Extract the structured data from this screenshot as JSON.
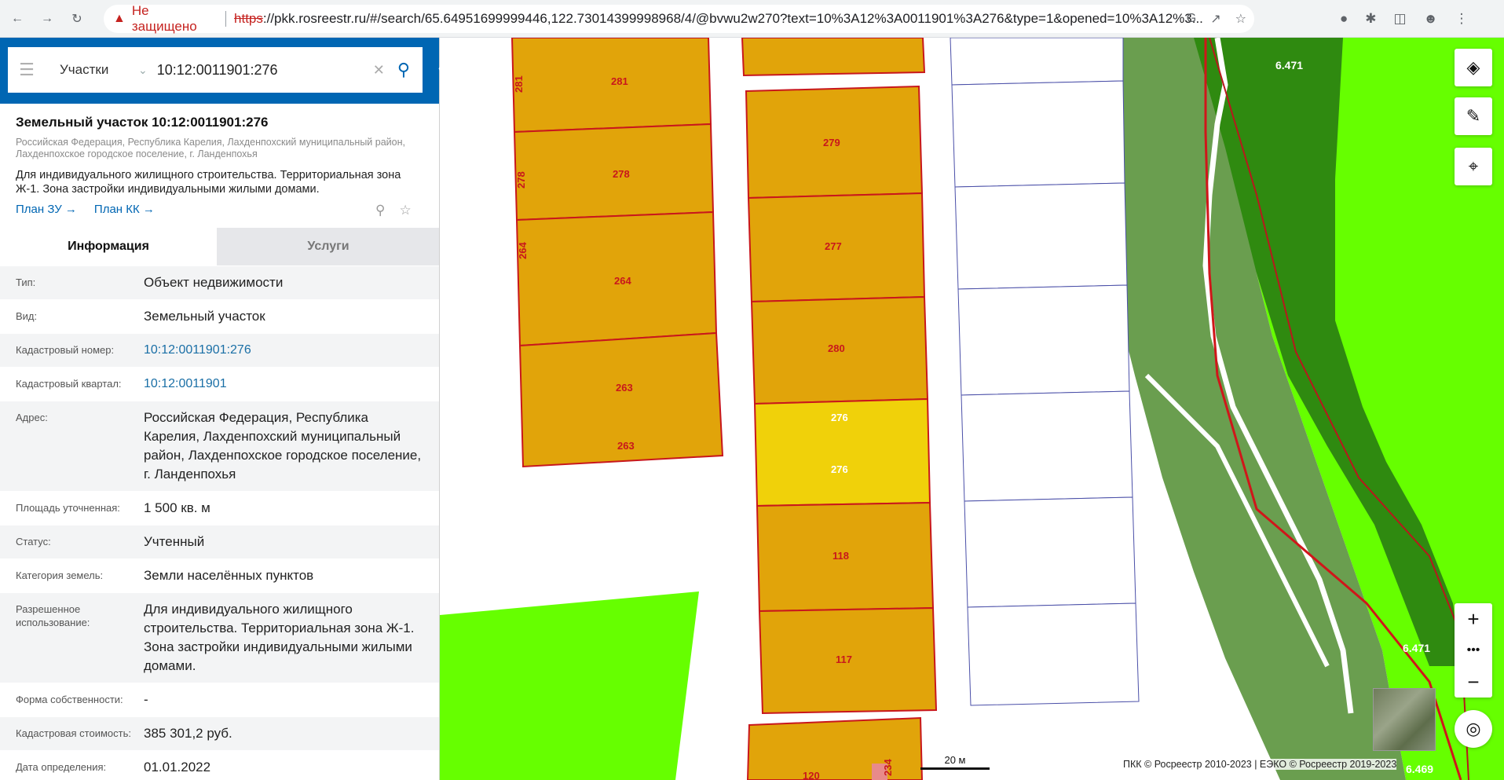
{
  "browser": {
    "warning_label": "Не защищено",
    "url_scheme": "https",
    "url_rest": "://pkk.rosreestr.ru/#/search/65.64951699999446,122.73014399998968/4/@bvwu2w270?text=10%3A12%3A0011901%3A276&type=1&opened=10%3A12%3..."
  },
  "search": {
    "type_label": "Участки",
    "query": "10:12:0011901:276"
  },
  "object": {
    "title": "Земельный участок 10:12:0011901:276",
    "address": "Российская Федерация, Республика Карелия, Лахденпохский муниципальный район, Лахденпохское городское поселение, г. Ланденпохья",
    "description": "Для индивидуального жилищного строительства. Территориальная зона Ж-1. Зона застройки индивидуальными жилыми домами.",
    "link_plan_zu": "План ЗУ →",
    "link_plan_kk": "План КК →"
  },
  "tabs": {
    "info": "Информация",
    "services": "Услуги"
  },
  "info": {
    "type_label": "Тип:",
    "type_value": "Объект недвижимости",
    "kind_label": "Вид:",
    "kind_value": "Земельный участок",
    "cad_num_label": "Кадастровый номер:",
    "cad_num_value": "10:12:0011901:276",
    "cad_block_label": "Кадастровый квартал:",
    "cad_block_value": "10:12:0011901",
    "address_label": "Адрес:",
    "address_value": "Российская Федерация, Республика Карелия, Лахденпохский муниципальный район, Лахденпохское городское поселение, г. Ланденпохья",
    "area_label": "Площадь уточненная:",
    "area_value": "1 500 кв. м",
    "status_label": "Статус:",
    "status_value": "Учтенный",
    "category_label": "Категория земель:",
    "category_value": "Земли населённых пунктов",
    "usage_label": "Разрешенное использование:",
    "usage_value": "Для индивидуального жилищного строительства. Территориальная зона Ж-1. Зона застройки индивидуальными жилыми домами.",
    "ownership_label": "Форма собственности:",
    "ownership_value": "-",
    "cost_label": "Кадастровая стоимость:",
    "cost_value": "385 301,2 руб.",
    "date_label": "Дата определения:",
    "date_value": "01.01.2022"
  },
  "map": {
    "parcels": {
      "p281": "281",
      "p281side": "281",
      "p278": "278",
      "p278side": "278",
      "p264": "264",
      "p264side": "264",
      "p263": "263",
      "p263b": "263",
      "p279": "279",
      "p277": "277",
      "p280": "280",
      "p276": "276",
      "p276b": "276",
      "p118": "118",
      "p117": "117",
      "p120": "120",
      "p234": "234"
    },
    "water_label_top": "6.471",
    "water_label_mid": "6.471",
    "water_label_bottom": "6.469",
    "scale_label": "20 м",
    "attribution": "ПКК © Росреестр 2010-2023 | ЕЭКО © Росреестр 2019-2023",
    "colors": {
      "parcel": "#e1a40a",
      "selected": "#f0d10a",
      "border": "#c8171c",
      "green": "#66ff00",
      "wetland": "#6a9e4f",
      "forest": "#2f8a10"
    }
  }
}
